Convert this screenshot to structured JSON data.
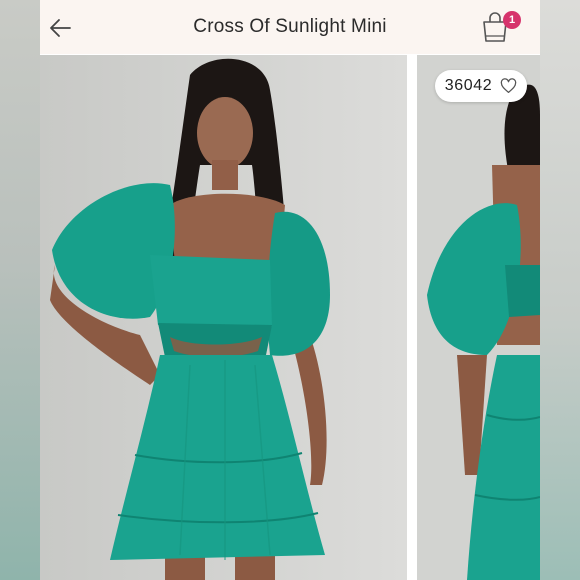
{
  "header": {
    "title": "Cross Of Sunlight Mini",
    "back_icon": "arrow-left-icon",
    "cart_icon": "shopping-bag-icon",
    "cart_count": "1",
    "badge_color": "#d6336c"
  },
  "listing": {
    "likes_count": "36042",
    "like_icon": "heart-outline-icon",
    "dress_color": "#1aa38f"
  }
}
